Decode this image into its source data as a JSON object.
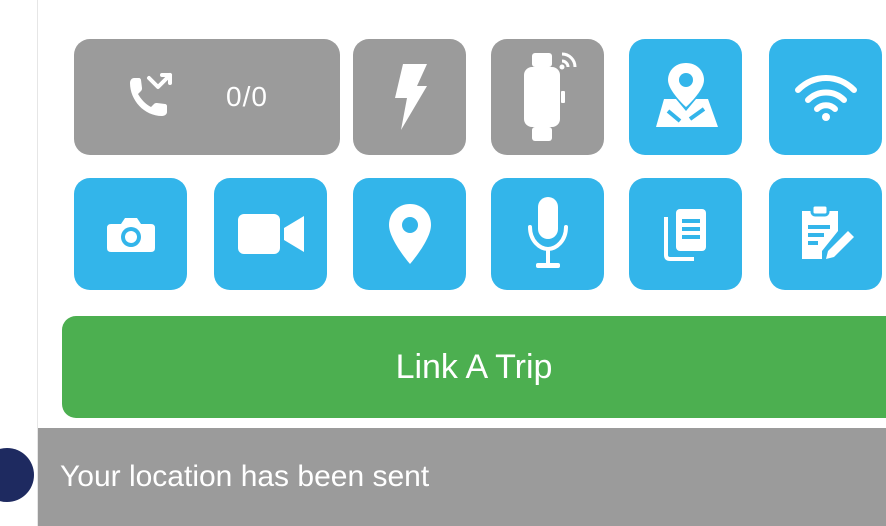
{
  "toolbar": {
    "call": {
      "icon": "phone-missed-icon",
      "count": "0/0",
      "state": "disabled"
    },
    "row1": [
      {
        "icon": "flash-icon",
        "state": "disabled"
      },
      {
        "icon": "smartwatch-icon",
        "state": "disabled"
      },
      {
        "icon": "map-location-icon",
        "state": "active"
      },
      {
        "icon": "wifi-icon",
        "state": "active"
      }
    ],
    "row2": [
      {
        "icon": "camera-icon",
        "state": "active"
      },
      {
        "icon": "video-camera-icon",
        "state": "active"
      },
      {
        "icon": "location-pin-icon",
        "state": "active"
      },
      {
        "icon": "microphone-icon",
        "state": "active"
      },
      {
        "icon": "documents-icon",
        "state": "active"
      },
      {
        "icon": "clipboard-edit-icon",
        "state": "active"
      }
    ]
  },
  "link_trip": {
    "label": "Link A Trip"
  },
  "toast": {
    "message": "Your location has been sent"
  },
  "colors": {
    "active": "#33b5ea",
    "disabled": "#9b9b9b",
    "primary_action": "#4caf50",
    "toast_bg": "#9b9b9b",
    "indicator": "#1e2a60"
  }
}
